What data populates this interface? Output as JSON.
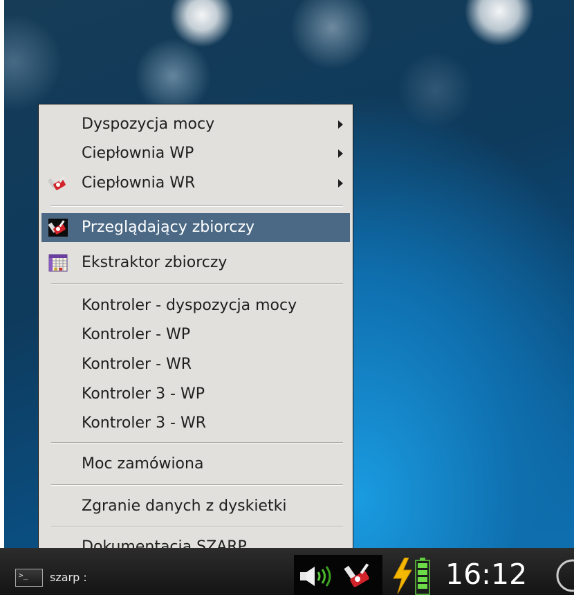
{
  "menu": {
    "items": [
      {
        "label": "Dyspozycja mocy",
        "has_submenu": true,
        "icon": null
      },
      {
        "label": "Ciepłownia WP",
        "has_submenu": true,
        "icon": null
      },
      {
        "label": "Ciepłownia WR",
        "has_submenu": true,
        "icon": "szarp-viewer-icon"
      },
      {
        "label": "Przeglądający zbiorczy",
        "has_submenu": false,
        "icon": "szarp-viewer-icon",
        "highlighted": true
      },
      {
        "label": "Ekstraktor zbiorczy",
        "has_submenu": false,
        "icon": "spreadsheet-grid-icon"
      },
      {
        "label": "Kontroler - dyspozycja mocy",
        "has_submenu": false,
        "icon": null
      },
      {
        "label": "Kontroler - WP",
        "has_submenu": false,
        "icon": null
      },
      {
        "label": "Kontroler - WR",
        "has_submenu": false,
        "icon": null
      },
      {
        "label": "Kontroler 3 - WP",
        "has_submenu": false,
        "icon": null
      },
      {
        "label": "Kontroler 3 - WR",
        "has_submenu": false,
        "icon": null
      },
      {
        "label": "Moc zamówiona",
        "has_submenu": false,
        "icon": null
      },
      {
        "label": "Zgranie danych z dyskietki",
        "has_submenu": false,
        "icon": null
      },
      {
        "label": "Dokumentacja SZARP",
        "has_submenu": false,
        "icon": null
      }
    ],
    "highlight_color": "#4b6985",
    "background_color": "#e2e0dc"
  },
  "taskbar": {
    "task_label": "szarp :",
    "task_icon": "terminal-icon",
    "tray_icons": [
      "speaker-volume-icon",
      "szarp-viewer-icon",
      "lightning-power-icon",
      "battery-icon"
    ],
    "clock": "16:12"
  }
}
